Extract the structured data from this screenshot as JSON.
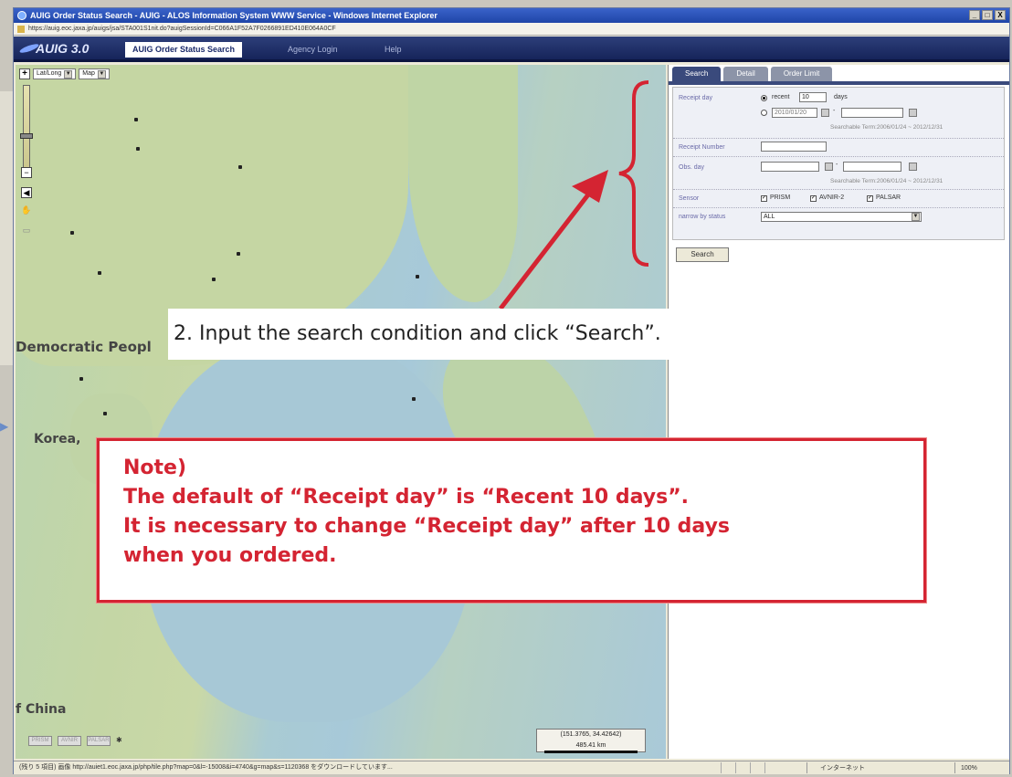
{
  "window": {
    "title": "AUIG Order Status Search - AUIG - ALOS Information System WWW Service - Windows Internet Explorer",
    "address": "https://auig.eoc.jaxa.jp/auigs/jsa/STA001S1nit.do?auigSessionId=C066A1F52A7F0266891ED410E064A0CF",
    "controls": [
      "_",
      "□",
      "X"
    ]
  },
  "app": {
    "logo": "AUIG 3.0",
    "tabs": [
      "AUIG Order Status Search",
      "Agency Login",
      "Help"
    ]
  },
  "map": {
    "coord_select": "Lat/Long",
    "layer_select": "Map",
    "labels": {
      "democratic": "Democratic Peopl",
      "korea": "Korea,",
      "china": "f China"
    },
    "coordinates": "(151.3765, 34.42642)",
    "scale": "485.41 km",
    "mini_buttons": [
      "PRISM",
      "AVNIR",
      "PALSAR"
    ]
  },
  "panel": {
    "tabs": [
      "Search",
      "Detail",
      "Order Limit"
    ],
    "receipt_day_label": "Receipt day",
    "recent_label": "recent",
    "recent_value": "10",
    "days_label": "days",
    "date_placeholder": "2010/01/20",
    "searchable_term_1": "Searchable Term:2006/01/24 ~ 2012/12/31",
    "receipt_number_label": "Receipt Number",
    "obs_day_label": "Obs. day",
    "searchable_term_2": "Searchable Term:2006/01/24 ~ 2012/12/31",
    "sensor_label": "Sensor",
    "sensors": [
      "PRISM",
      "AVNIR-2",
      "PALSAR"
    ],
    "status_label": "narrow by status",
    "status_value": "ALL",
    "search_button": "Search",
    "dash": "-"
  },
  "callout": {
    "text": "2. Input the search condition and click “Search”."
  },
  "note": {
    "lines": [
      "Note)",
      "The default of “Receipt day” is “Recent 10 days”.",
      "It is necessary to change “Receipt day” after 10 days",
      "when you ordered."
    ]
  },
  "statusbar": {
    "text": "(残り 5 項目) 画像 http://auiet1.eoc.jaxa.jp/php/tile.php?map=0&l=-15008&i=4740&g=map&s=1120368 をダウンロードしています...",
    "zone": "インターネット",
    "zoom": "100%"
  },
  "colors": {
    "accent_red": "#d42432",
    "nav_blue": "#1f2f6a"
  }
}
